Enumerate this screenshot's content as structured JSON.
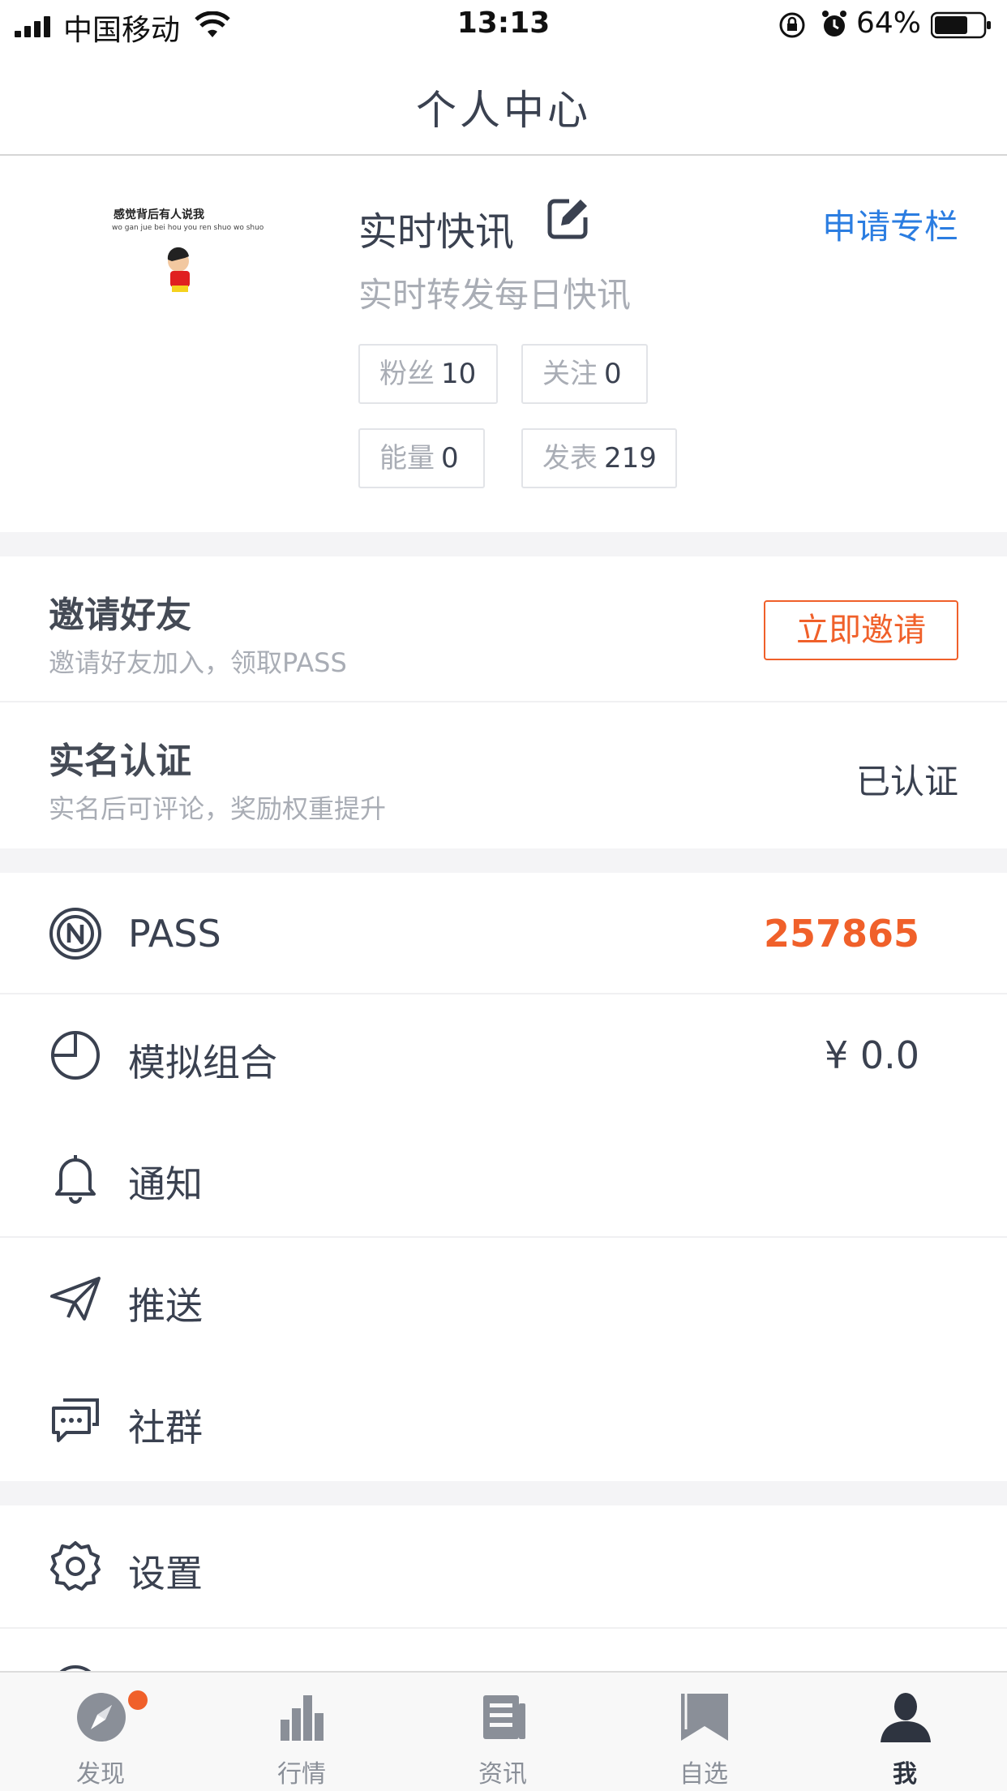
{
  "status_bar": {
    "carrier": "中国移动",
    "time": "13:13",
    "battery": "64%"
  },
  "nav": {
    "title": "个人中心"
  },
  "profile": {
    "avatar_text": "感觉背后有人说我",
    "avatar_subtext": "wo gan jue bei hou you ren shuo wo shuo",
    "name": "实时快讯",
    "apply_label": "申请专栏",
    "bio": "实时转发每日快讯",
    "stats": [
      {
        "label": "粉丝",
        "value": "10"
      },
      {
        "label": "关注",
        "value": "0"
      },
      {
        "label": "能量",
        "value": "0"
      },
      {
        "label": "发表",
        "value": "219"
      }
    ]
  },
  "invite": {
    "title": "邀请好友",
    "subtitle": "邀请好友加入，领取PASS",
    "button": "立即邀请"
  },
  "realname": {
    "title": "实名认证",
    "subtitle": "实名后可评论，奖励权重提升",
    "status": "已认证"
  },
  "menu": [
    {
      "icon": "pass-coin-icon",
      "label": "PASS",
      "value": "257865"
    },
    {
      "icon": "pie-chart-icon",
      "label": "模拟组合",
      "value": "¥ 0.0"
    },
    {
      "icon": "bell-icon",
      "label": "通知",
      "value": ""
    },
    {
      "icon": "paper-plane-icon",
      "label": "推送",
      "value": ""
    },
    {
      "icon": "chat-bubbles-icon",
      "label": "社群",
      "value": ""
    }
  ],
  "settings": {
    "icon": "gear-icon",
    "label": "设置"
  },
  "tabs": [
    {
      "icon": "compass-icon",
      "label": "发现",
      "badge": true
    },
    {
      "icon": "bar-chart-icon",
      "label": "行情"
    },
    {
      "icon": "news-icon",
      "label": "资讯"
    },
    {
      "icon": "bookmark-icon",
      "label": "自选"
    },
    {
      "icon": "user-icon",
      "label": "我",
      "active": true
    }
  ],
  "colors": {
    "accent_orange": "#f0602a",
    "link_blue": "#2b7de1",
    "text_dark": "#3a4150",
    "text_muted": "#a9adb5"
  }
}
